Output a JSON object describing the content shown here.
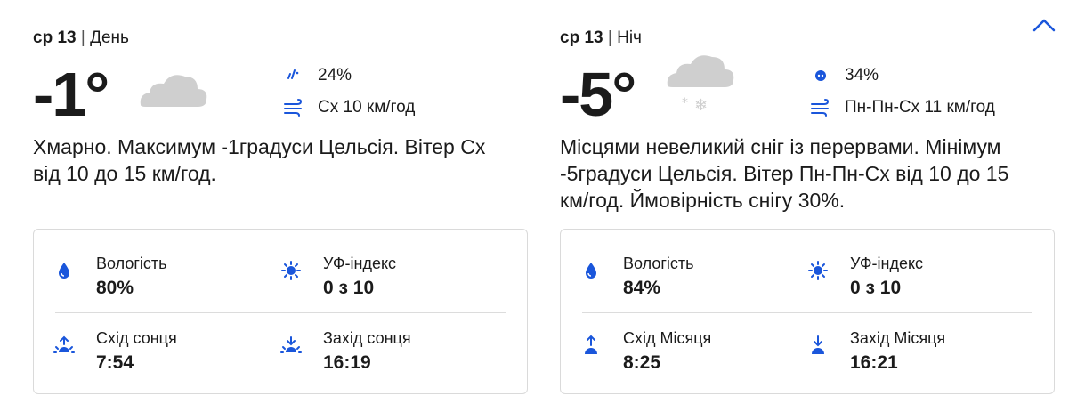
{
  "colors": {
    "accent": "#1a56db",
    "cloud": "#cfcfcf",
    "text": "#1b1b1b"
  },
  "day": {
    "date_label": "ср 13",
    "period_label": "День",
    "temperature": "-1°",
    "condition_icon": "cloud-icon",
    "precip_chance": "24%",
    "wind": "Сх 10 км/год",
    "description": "Хмарно. Максимум -1градуси Цельсія. Вітер Сх від 10 до 15 км/год.",
    "humidity_label": "Вологість",
    "humidity_value": "80%",
    "uv_label": "УФ-індекс",
    "uv_value": "0 з 10",
    "rise_label": "Схід сонця",
    "rise_value": "7:54",
    "set_label": "Захід сонця",
    "set_value": "16:19"
  },
  "night": {
    "date_label": "ср 13",
    "period_label": "Ніч",
    "temperature": "-5°",
    "condition_icon": "snow-cloud-icon",
    "precip_chance": "34%",
    "wind": "Пн-Пн-Сх 11 км/год",
    "description": "Місцями невеликий сніг із перервами. Мінімум -5градуси Цельсія. Вітер Пн-Пн-Сх від 10 до 15 км/год. Ймовірність снігу 30%.",
    "humidity_label": "Вологість",
    "humidity_value": "84%",
    "uv_label": "УФ-індекс",
    "uv_value": "0 з 10",
    "rise_label": "Схід Місяця",
    "rise_value": "8:25",
    "set_label": "Захід Місяця",
    "set_value": "16:21"
  }
}
